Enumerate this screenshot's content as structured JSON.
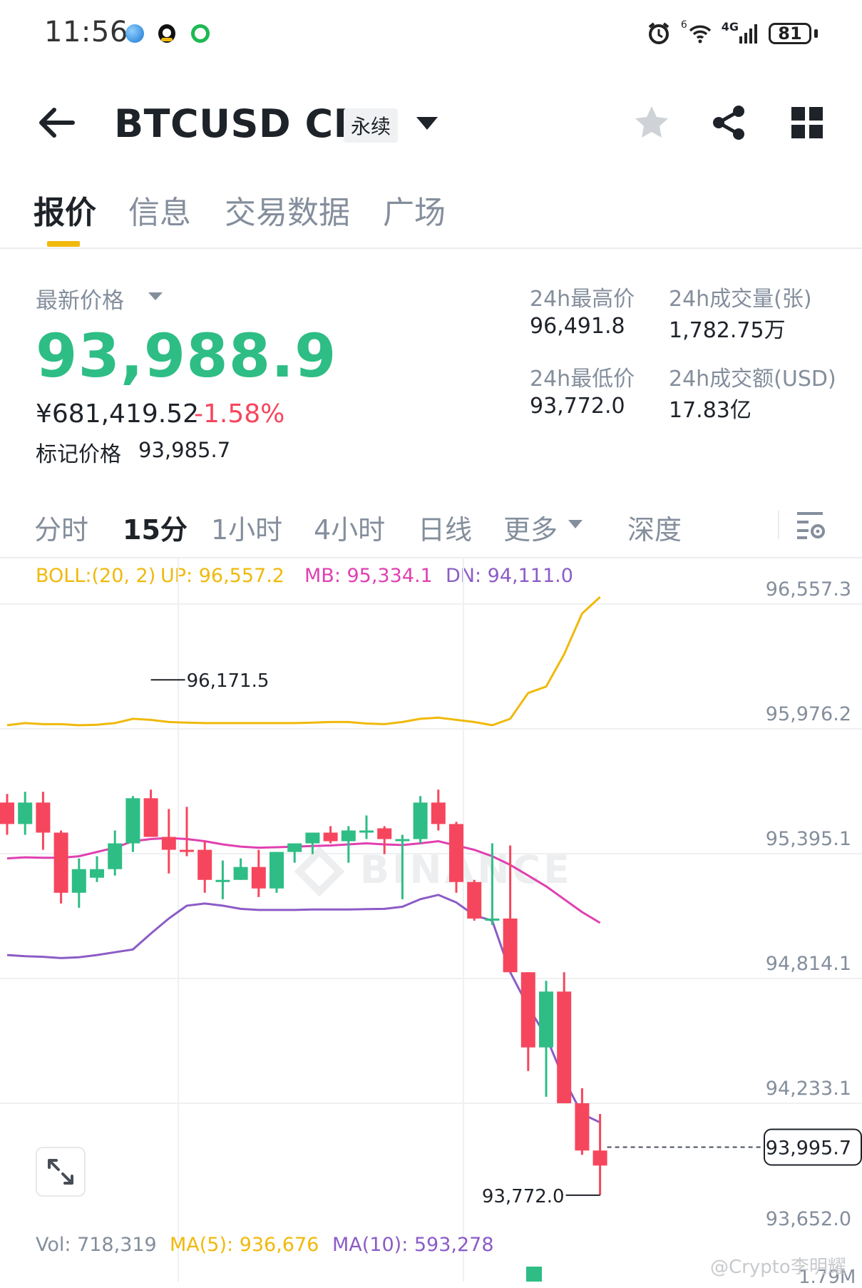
{
  "status_bar": {
    "time": "11:56",
    "signal_sup": "6",
    "net_label": "4G",
    "battery": "81"
  },
  "header": {
    "symbol": "BTCUSD CM",
    "contract_tag": "永续",
    "icons": [
      "back-arrow-icon",
      "star-icon",
      "share-icon",
      "grid-icon"
    ]
  },
  "tabs": [
    {
      "label": "报价",
      "active": true
    },
    {
      "label": "信息",
      "active": false
    },
    {
      "label": "交易数据",
      "active": false
    },
    {
      "label": "广场",
      "active": false
    }
  ],
  "price": {
    "latest_label": "最新价格",
    "latest": "93,988.9",
    "cny": "¥681,419.52",
    "change": "-1.58%",
    "mark_label": "标记价格",
    "mark": "93,985.7"
  },
  "stats": {
    "high_label": "24h最高价",
    "high": "96,491.8",
    "low_label": "24h最低价",
    "low": "93,772.0",
    "vol_label": "24h成交量(张)",
    "vol": "1,782.75万",
    "amount_label": "24h成交额(USD)",
    "amount": "17.83亿"
  },
  "intervals": [
    {
      "label": "分时",
      "active": false
    },
    {
      "label": "15分",
      "active": true
    },
    {
      "label": "1小时",
      "active": false
    },
    {
      "label": "4小时",
      "active": false
    },
    {
      "label": "日线",
      "active": false
    },
    {
      "label": "更多",
      "active": false
    },
    {
      "label": "深度",
      "active": false
    }
  ],
  "indicators": {
    "boll": "BOLL:(20, 2)",
    "up": "UP: 96,557.2",
    "mb": "MB: 95,334.1",
    "dn": "DN: 94,111.0"
  },
  "colors": {
    "up": "#2ebd85",
    "down": "#f6465d",
    "boll_up": "#f0b90b",
    "boll_mb": "#e040b0",
    "boll_dn": "#8b5cc6",
    "accent": "#f0b90b"
  },
  "chart_data": {
    "type": "candlestick",
    "y_ticks": [
      "96,557.3",
      "95,976.2",
      "95,395.1",
      "94,814.1",
      "94,233.1",
      "93,652.0"
    ],
    "ylim": [
      93652.0,
      96557.3
    ],
    "max_label": "96,171.5",
    "min_label": "93,772.0",
    "current_price_label": "93,995.7",
    "watermark": "BINANCE",
    "candles": [
      [
        95600,
        95640,
        95450,
        95500
      ],
      [
        95500,
        95650,
        95450,
        95600
      ],
      [
        95600,
        95650,
        95380,
        95460
      ],
      [
        95460,
        95470,
        95130,
        95180
      ],
      [
        95180,
        95340,
        95110,
        95290
      ],
      [
        95250,
        95350,
        95230,
        95290
      ],
      [
        95290,
        95470,
        95260,
        95410
      ],
      [
        95410,
        95630,
        95370,
        95620
      ],
      [
        95620,
        95660,
        95590,
        95440
      ],
      [
        95440,
        95570,
        95270,
        95380
      ],
      [
        95380,
        95580,
        95350,
        95370
      ],
      [
        95380,
        95420,
        95180,
        95240
      ],
      [
        95240,
        95330,
        95150,
        95240
      ],
      [
        95240,
        95340,
        95240,
        95300
      ],
      [
        95300,
        95380,
        95160,
        95200
      ],
      [
        95200,
        95370,
        95180,
        95370
      ],
      [
        95370,
        95410,
        95320,
        95410
      ],
      [
        95410,
        95450,
        95360,
        95460
      ],
      [
        95460,
        95490,
        95410,
        95420
      ],
      [
        95420,
        95490,
        95320,
        95470
      ],
      [
        95470,
        95540,
        95430,
        95470
      ],
      [
        95480,
        95490,
        95360,
        95430
      ],
      [
        95430,
        95450,
        95150,
        95430
      ],
      [
        95430,
        95630,
        95410,
        95600
      ],
      [
        95600,
        95660,
        95470,
        95500
      ],
      [
        95500,
        95510,
        95180,
        95230
      ],
      [
        95230,
        95240,
        95050,
        95060
      ],
      [
        95060,
        95410,
        95030,
        95060
      ],
      [
        95060,
        95400,
        94830,
        94810
      ],
      [
        94810,
        94810,
        94350,
        94460
      ],
      [
        94460,
        94770,
        94230,
        94720
      ],
      [
        94720,
        94810,
        94200,
        94200
      ],
      [
        94200,
        94270,
        93960,
        93980
      ],
      [
        93980,
        94150,
        93772,
        93910
      ]
    ],
    "boll_up": [
      95960,
      95970,
      95965,
      95965,
      95960,
      95962,
      95970,
      95990,
      95985,
      95975,
      95972,
      95970,
      95970,
      95970,
      95970,
      95970,
      95970,
      95972,
      95975,
      95975,
      95968,
      95965,
      95975,
      95990,
      95995,
      95985,
      95975,
      95960,
      95990,
      96110,
      96140,
      96290,
      96480,
      96557
    ],
    "boll_mb": [
      95340,
      95345,
      95343,
      95343,
      95350,
      95370,
      95390,
      95420,
      95430,
      95435,
      95430,
      95420,
      95405,
      95395,
      95390,
      95392,
      95395,
      95398,
      95400,
      95405,
      95410,
      95405,
      95402,
      95410,
      95420,
      95400,
      95380,
      95350,
      95310,
      95260,
      95210,
      95150,
      95090,
      95040
    ],
    "boll_dn": [
      94890,
      94885,
      94882,
      94876,
      94880,
      94890,
      94903,
      94916,
      94990,
      95060,
      95120,
      95130,
      95120,
      95105,
      95100,
      95100,
      95100,
      95102,
      95102,
      95102,
      95104,
      95105,
      95115,
      95150,
      95170,
      95135,
      95075,
      95050,
      94810,
      94650,
      94510,
      94310,
      94150,
      94111
    ]
  },
  "volume": {
    "vol": "Vol: 718,319",
    "ma5": "MA(5): 936,676",
    "ma10": "MA(10): 593,278",
    "axis_label": "1.79M"
  },
  "watermark_text": "@Crypto李明耀"
}
